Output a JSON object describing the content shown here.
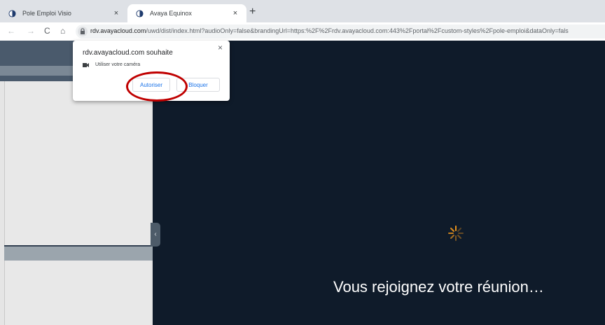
{
  "tabs": [
    {
      "title": "Pole Emploi Visio",
      "close": "×"
    },
    {
      "title": "Avaya Equinox",
      "close": "×"
    }
  ],
  "new_tab": "+",
  "nav": {
    "back": "←",
    "forward": "→",
    "reload": "C",
    "home": "⌂"
  },
  "address": {
    "host": "rdv.avayacloud.com",
    "path": "/uwd/dist/index.html?audioOnly=false&brandingUrl=https:%2F%2Frdv.avayacloud.com:443%2Fportal%2Fcustom-styles%2Fpole-emploi&dataOnly=fals"
  },
  "permission_popup": {
    "origin": "rdv.avayacloud.com souhaite",
    "close": "×",
    "permission": "Utiliser votre caméra",
    "allow_label": "Autoriser",
    "block_label": "Bloquer"
  },
  "panel": {
    "collapse_glyph": "‹"
  },
  "main": {
    "status": "Vous rejoignez votre réunion…"
  },
  "colors": {
    "accent_blue": "#1a73e8",
    "highlight_red": "#c00000",
    "spinner_orange": "#e8931d",
    "stage_bg": "#0f1b2a"
  },
  "icons": [
    "tab-favicon-icon",
    "lock-icon",
    "camera-icon",
    "loading-spinner-icon"
  ]
}
